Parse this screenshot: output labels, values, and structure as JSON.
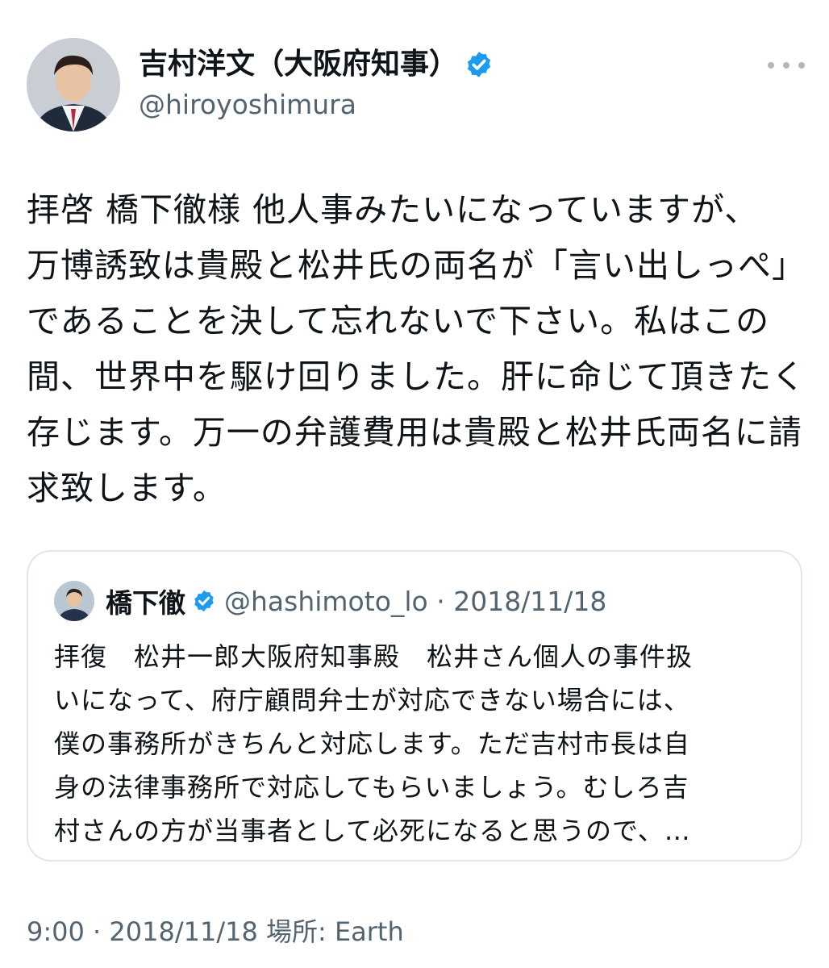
{
  "tweet": {
    "display_name": "吉村洋文（大阪府知事）",
    "handle": "@hiroyoshimura",
    "body_lines": [
      "拝啓  橋下徹様  他人事みたいになっていますが、",
      "万博誘致は貴殿と松井氏の両名が「言い出しっぺ」",
      "であることを決して忘れないで下さい。私はこの",
      "間、世界中を駆け回りました。肝に命じて頂きたく",
      "存じます。万一の弁護費用は貴殿と松井氏両名に請",
      "求致します。"
    ],
    "footer": "9:00 · 2018/11/18 場所: Earth"
  },
  "quoted_tweet": {
    "display_name": "橋下徹",
    "meta": "@hashimoto_lo · 2018/11/18",
    "body_lines": [
      "拝復　松井一郎大阪府知事殿　松井さん個人の事件扱",
      "いになって、府庁顧問弁士が対応できない場合には、",
      "僕の事務所がきちんと対応します。ただ吉村市長は自",
      "身の法律事務所で対応してもらいましょう。むしろ吉",
      "村さんの方が当事者として必死になると思うので、…"
    ]
  },
  "icons": {
    "verified": "verified-badge-icon",
    "more": "more-options-icon"
  },
  "colors": {
    "verified_blue": "#1d9bf0",
    "secondary_text": "#536471",
    "border": "#e2e6ea"
  }
}
